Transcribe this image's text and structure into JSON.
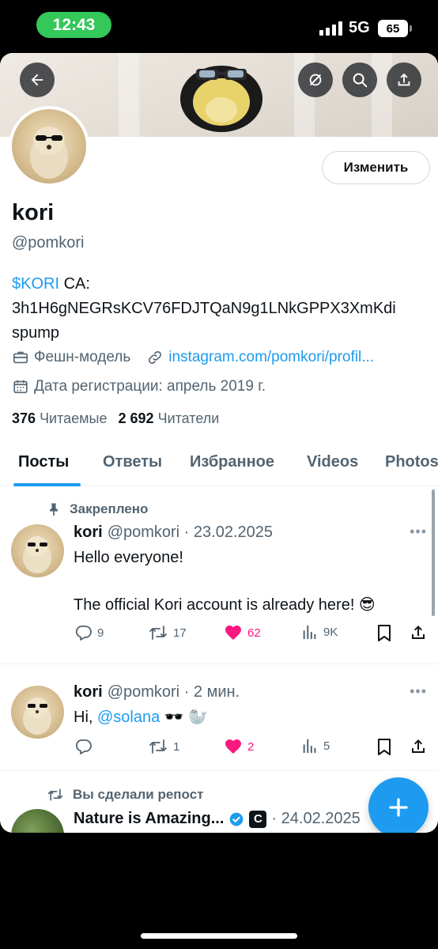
{
  "status_bar": {
    "time": "12:43",
    "network": "5G",
    "battery": "65"
  },
  "profile": {
    "edit_label": "Изменить",
    "name": "kori",
    "handle": "@pomkori",
    "bio_token": "$KORI",
    "bio_line1_rest": " CA:",
    "bio_line2": "3h1H6gNEGRsKCV76FDJTQaN9g1LNkGPPX3XmKdi",
    "bio_line3": "spump",
    "category": "Фешн-модель",
    "link": "instagram.com/pomkori/profil...",
    "joined": "Дата регистрации: апрель 2019 г.",
    "following_count": "376",
    "following_label": "Читаемые",
    "followers_count": "2 692",
    "followers_label": "Читатели"
  },
  "tabs": [
    "Посты",
    "Ответы",
    "Избранное",
    "Videos",
    "Photos"
  ],
  "posts": [
    {
      "context": "Закреплено",
      "name": "kori",
      "meta": "@pomkori · 23.02.2025",
      "line1": "Hello everyone!",
      "line2": "The official Kori account is already here! 😎",
      "replies": "9",
      "reposts": "17",
      "likes": "62",
      "views": "9K"
    },
    {
      "name": "kori",
      "meta": "@pomkori · 2 мин.",
      "text_prefix": "Hi, ",
      "mention": "@solana",
      "text_suffix": " 🕶️ 🦭",
      "replies": "",
      "reposts": "1",
      "likes": "2",
      "views": "5"
    },
    {
      "context": "Вы сделали репост",
      "name": "Nature is Amazing...",
      "meta": "· 24.02.2025"
    }
  ],
  "colors": {
    "accent": "#1d9bf0",
    "like": "#f91880",
    "status_pill": "#34c759"
  },
  "icons": [
    "back-arrow-icon",
    "no-sync-icon",
    "search-icon",
    "share-icon",
    "briefcase-icon",
    "link-icon",
    "calendar-icon",
    "pin-icon",
    "repost-icon",
    "reply-icon",
    "like-icon",
    "views-icon",
    "bookmark-icon",
    "verified-icon",
    "plus-icon"
  ]
}
